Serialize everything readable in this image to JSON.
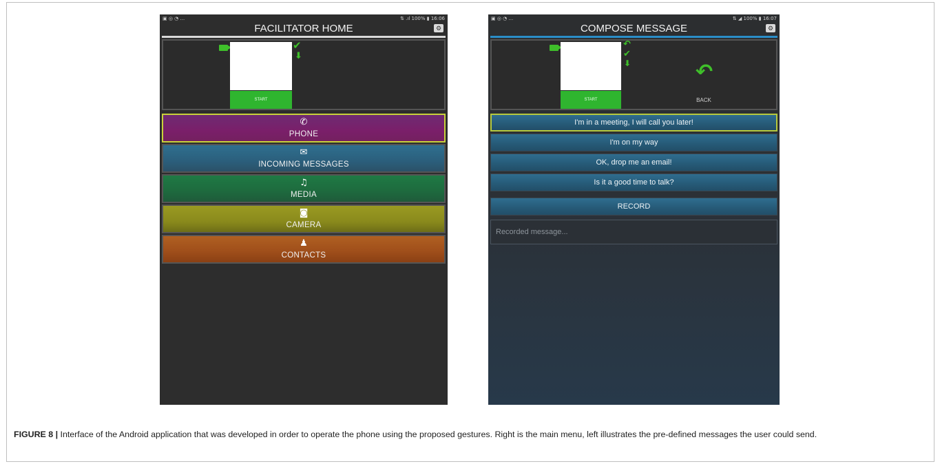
{
  "left_screen": {
    "status_left": "▣ ◎ ◔ ...",
    "status_right": "⇅ .ıl 100% ▮ 16:06",
    "title": "FACILITATOR HOME",
    "settings_icon": "gear-icon",
    "start_label": "START",
    "menu": [
      {
        "id": "phone",
        "label": "PHONE",
        "icon": "✆"
      },
      {
        "id": "incoming",
        "label": "INCOMING MESSAGES",
        "icon": "✉"
      },
      {
        "id": "media",
        "label": "MEDIA",
        "icon": "♫"
      },
      {
        "id": "camera",
        "label": "CAMERA",
        "icon": "◙"
      },
      {
        "id": "contacts",
        "label": "CONTACTS",
        "icon": "♟"
      }
    ]
  },
  "right_screen": {
    "status_left": "▣ ◎ ◔ ...",
    "status_right": "⇅ ◢ 100% ▮ 16:07",
    "title": "COMPOSE MESSAGE",
    "settings_icon": "gear-icon",
    "start_label": "START",
    "back_label": "BACK",
    "messages": [
      "I'm in a meeting, I will call you later!",
      "I'm on my way",
      "OK, drop me an email!",
      "Is it a good time to talk?"
    ],
    "record_label": "RECORD",
    "recorded_placeholder": "Recorded message..."
  },
  "caption": {
    "label": "FIGURE 8 |",
    "text": " Interface of the Android application that was developed in order to operate the phone using the proposed gestures. Right is the main menu, left illustrates the pre-defined messages the user could send."
  },
  "colors": {
    "accent_green": "#3fbf2a",
    "phone_btn": "#7a1f6a",
    "incoming_btn": "#2b5f7c",
    "media_btn": "#1e6a3e",
    "camera_btn": "#8a8a1c",
    "contacts_btn": "#9f4e1a",
    "compose_rule": "#2a8ec8"
  }
}
